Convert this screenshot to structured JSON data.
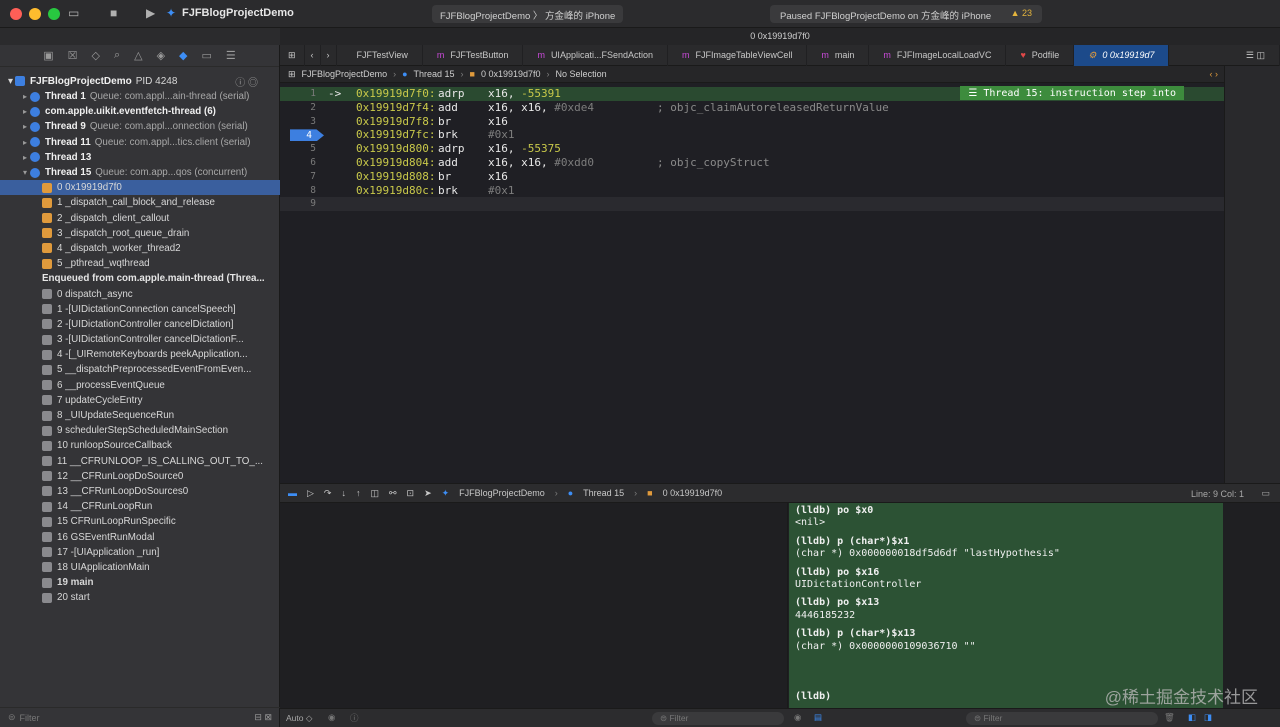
{
  "window": {
    "project_title": "FJFBlogProjectDemo",
    "scheme": "FJFBlogProjectDemo 〉 方金峰的 iPhone",
    "status": "Paused FJFBlogProjectDemo on 方金峰的 iPhone",
    "warnings": "23",
    "subtitle": "0 0x19919d7f0"
  },
  "navigator": {
    "process_name": "FJFBlogProjectDemo",
    "process_pid": "PID 4248",
    "threads": [
      {
        "name": "Thread 1",
        "queue": "Queue: com.appl...ain-thread (serial)"
      },
      {
        "name": "com.apple.uikit.eventfetch-thread (6)",
        "queue": ""
      },
      {
        "name": "Thread 9",
        "queue": "Queue: com.appl...onnection (serial)"
      },
      {
        "name": "Thread 11",
        "queue": "Queue: com.appl...tics.client (serial)"
      },
      {
        "name": "Thread 13",
        "queue": ""
      },
      {
        "name": "Thread 15",
        "queue": "Queue: com.app...qos (concurrent)"
      }
    ],
    "frames": [
      "0 0x19919d7f0",
      "1 _dispatch_call_block_and_release",
      "2 _dispatch_client_callout",
      "3 _dispatch_root_queue_drain",
      "4 _dispatch_worker_thread2",
      "5 _pthread_wqthread"
    ],
    "enqueued_label": "Enqueued from com.apple.main-thread (Threa...",
    "enqueued_frames": [
      "0 dispatch_async",
      "1 -[UIDictationConnection cancelSpeech]",
      "2 -[UIDictationController cancelDictation]",
      "3 -[UIDictationController cancelDictationF...",
      "4 -[_UIRemoteKeyboards peekApplication...",
      "5 __dispatchPreprocessedEventFromEven...",
      "6 __processEventQueue",
      "7 updateCycleEntry",
      "8 _UIUpdateSequenceRun",
      "9 schedulerStepScheduledMainSection",
      "10 runloopSourceCallback",
      "11 __CFRUNLOOP_IS_CALLING_OUT_TO_...",
      "12 __CFRunLoopDoSource0",
      "13 __CFRunLoopDoSources0",
      "14 __CFRunLoopRun",
      "15 CFRunLoopRunSpecific",
      "16 GSEventRunModal",
      "17 -[UIApplication _run]",
      "18 UIApplicationMain",
      "19 main",
      "20 start"
    ],
    "filter_placeholder": "Filter"
  },
  "tabs": [
    {
      "label": "FJFTestView",
      "icon": ""
    },
    {
      "label": "FJFTestButton",
      "icon": "m"
    },
    {
      "label": "UIApplicati...FSendAction",
      "icon": "m"
    },
    {
      "label": "FJFImageTableViewCell",
      "icon": "m"
    },
    {
      "label": "main",
      "icon": "m"
    },
    {
      "label": "FJFImageLocalLoadVC",
      "icon": "m"
    },
    {
      "label": "Podfile",
      "icon": "♥"
    },
    {
      "label": "0 0x19919d7",
      "icon": "⚙"
    }
  ],
  "jumpbar": {
    "project": "FJFBlogProjectDemo",
    "thread": "Thread 15",
    "frame": "0 0x19919d7f0",
    "selection": "No Selection"
  },
  "code": [
    {
      "ln": "1",
      "arrow": "->",
      "addr": "0x19919d7f0:",
      "op": "adrp",
      "args": "x16, ",
      "num": "-55391",
      "comment": ""
    },
    {
      "ln": "2",
      "arrow": "",
      "addr": "0x19919d7f4:",
      "op": "add",
      "args": "x16, x16, ",
      "num": "#0xde4",
      "comment": "; objc_claimAutoreleasedReturnValue"
    },
    {
      "ln": "3",
      "arrow": "",
      "addr": "0x19919d7f8:",
      "op": "br",
      "args": "x16",
      "num": "",
      "comment": ""
    },
    {
      "ln": "4",
      "arrow": "",
      "addr": "0x19919d7fc:",
      "op": "brk",
      "args": "",
      "num": "#0x1",
      "comment": ""
    },
    {
      "ln": "5",
      "arrow": "",
      "addr": "0x19919d800:",
      "op": "adrp",
      "args": "x16, ",
      "num": "-55375",
      "comment": ""
    },
    {
      "ln": "6",
      "arrow": "",
      "addr": "0x19919d804:",
      "op": "add",
      "args": "x16, x16, ",
      "num": "#0xdd0",
      "comment": "; objc_copyStruct"
    },
    {
      "ln": "7",
      "arrow": "",
      "addr": "0x19919d808:",
      "op": "br",
      "args": "x16",
      "num": "",
      "comment": ""
    },
    {
      "ln": "8",
      "arrow": "",
      "addr": "0x19919d80c:",
      "op": "brk",
      "args": "",
      "num": "#0x1",
      "comment": ""
    },
    {
      "ln": "9",
      "arrow": "",
      "addr": "",
      "op": "",
      "args": "",
      "num": "",
      "comment": ""
    }
  ],
  "step_banner": "Thread 15: instruction step into",
  "debugbar": {
    "project": "FJFBlogProjectDemo",
    "thread": "Thread 15",
    "frame": "0 0x19919d7f0",
    "linecol": "Line: 9  Col: 1"
  },
  "console": [
    {
      "cmd": "(lldb) po $x0",
      "out": "<nil>"
    },
    {
      "cmd": "(lldb) p (char*)$x1",
      "out": "(char *) 0x000000018df5d6df \"lastHypothesis\""
    },
    {
      "cmd": "(lldb) po $x16",
      "out": "UIDictationController"
    },
    {
      "cmd": "(lldb) po $x13",
      "out": "4446185232"
    },
    {
      "cmd": "(lldb) p (char*)$x13",
      "out": "(char *) 0x0000000109036710 \"\""
    }
  ],
  "console_prompt": "(lldb)",
  "bottom": {
    "auto_label": "Auto ◇",
    "filter_placeholder": "Filter"
  },
  "watermark": "@稀土掘金技术社区",
  "colors": {
    "accent": "#3d7fe0",
    "console_bg": "#2c5234",
    "highlight_line": "#2a4a30",
    "step_banner": "#3d8c3d"
  }
}
